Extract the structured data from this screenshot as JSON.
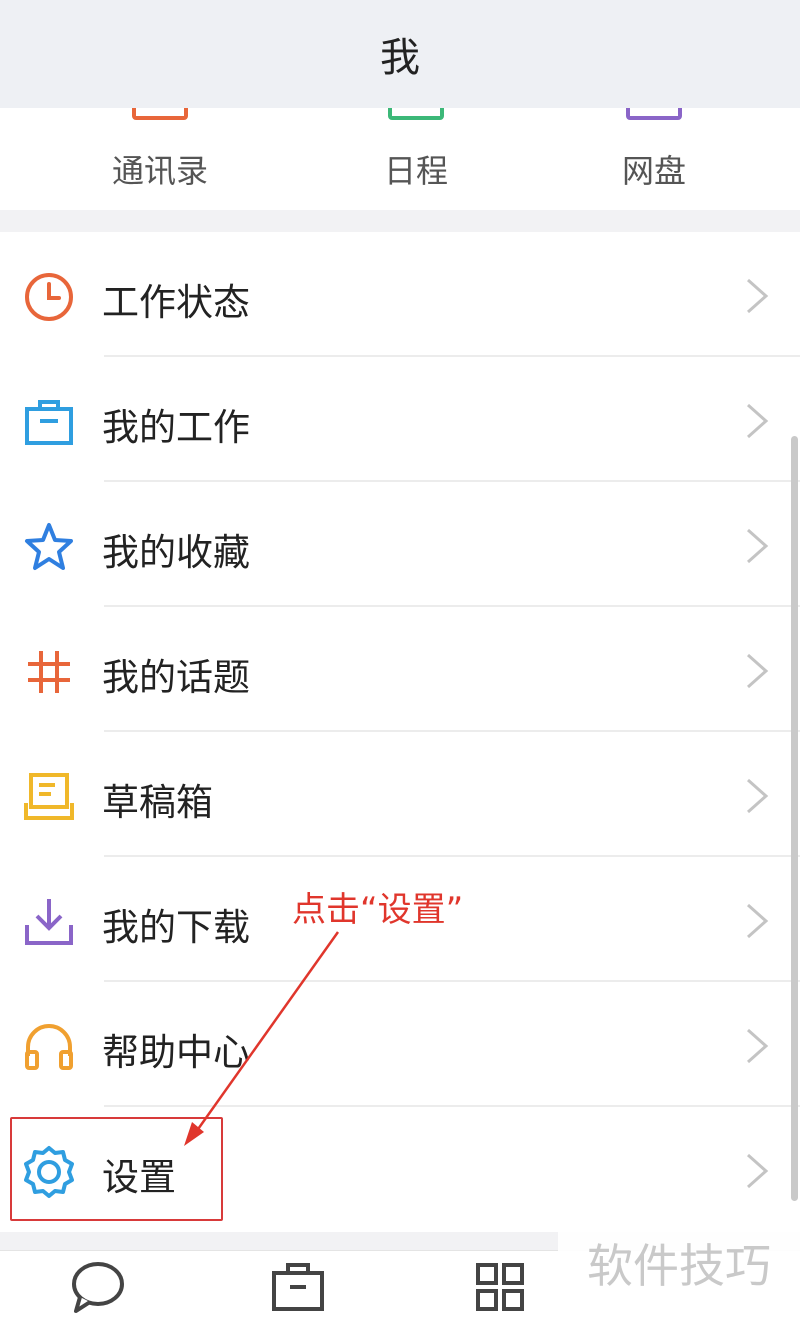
{
  "header": {
    "title": "我"
  },
  "quick_actions": [
    {
      "label": "通讯录",
      "icon": "contacts-icon",
      "color": "#e8663a"
    },
    {
      "label": "日程",
      "icon": "calendar-icon",
      "color": "#3cb878"
    },
    {
      "label": "网盘",
      "icon": "cloud-disk-icon",
      "color": "#8a65c8"
    }
  ],
  "menu": {
    "items": [
      {
        "label": "工作状态",
        "icon": "clock-icon",
        "color": "#e8663a"
      },
      {
        "label": "我的工作",
        "icon": "briefcase-icon",
        "color": "#2f9ee0"
      },
      {
        "label": "我的收藏",
        "icon": "star-icon",
        "color": "#2f7fe0"
      },
      {
        "label": "我的话题",
        "icon": "hashtag-icon",
        "color": "#e8663a"
      },
      {
        "label": "草稿箱",
        "icon": "drafts-tray-icon",
        "color": "#f0b82a"
      },
      {
        "label": "我的下载",
        "icon": "download-icon",
        "color": "#8a65c8"
      },
      {
        "label": "帮助中心",
        "icon": "headphones-icon",
        "color": "#f0a030"
      },
      {
        "label": "设置",
        "icon": "gear-icon",
        "color": "#2f9ee0"
      }
    ]
  },
  "annotation": {
    "text": "点击“设置”",
    "color": "#e0362c"
  },
  "bottom_tabs": [
    {
      "icon": "chat-bubble-icon"
    },
    {
      "icon": "briefcase-icon"
    },
    {
      "icon": "grid-apps-icon"
    }
  ],
  "watermark": {
    "text": "软件技巧"
  }
}
